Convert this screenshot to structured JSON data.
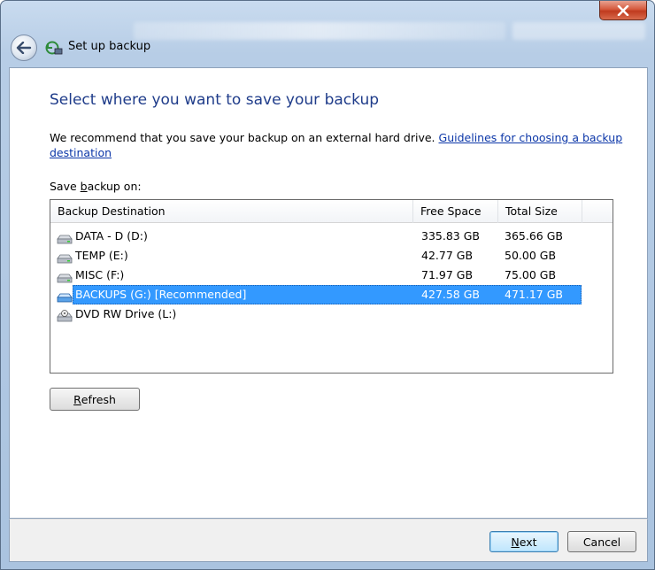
{
  "window": {
    "title": "Set up backup",
    "close_glyph": "✕"
  },
  "main": {
    "heading": "Select where you want to save your backup",
    "recommendation": "We recommend that you save your backup on an external hard drive.",
    "guidelines_link": "Guidelines for choosing a backup destination",
    "save_label_pre": "Save ",
    "save_label_accel": "b",
    "save_label_post": "ackup on:"
  },
  "list": {
    "columns": [
      "Backup Destination",
      "Free Space",
      "Total Size"
    ],
    "rows": [
      {
        "name": "DATA - D (D:)",
        "free": "335.83 GB",
        "total": "365.66 GB",
        "icon": "hard-drive-icon"
      },
      {
        "name": "TEMP (E:)",
        "free": "42.77 GB",
        "total": "50.00 GB",
        "icon": "hard-drive-icon"
      },
      {
        "name": "MISC (F:)",
        "free": "71.97 GB",
        "total": "75.00 GB",
        "icon": "hard-drive-icon"
      },
      {
        "name": "BACKUPS (G:) [Recommended]",
        "free": "427.58 GB",
        "total": "471.17 GB",
        "icon": "external-drive-icon",
        "selected": true
      },
      {
        "name": "DVD RW Drive (L:)",
        "free": "",
        "total": "",
        "icon": "dvd-drive-icon"
      }
    ]
  },
  "buttons": {
    "refresh_accel": "R",
    "refresh_rest": "efresh",
    "next_accel": "N",
    "next_rest": "ext",
    "cancel": "Cancel"
  },
  "colors": {
    "heading": "#1f3c8a",
    "link": "#0b36a8",
    "selection": "#3399ff"
  }
}
